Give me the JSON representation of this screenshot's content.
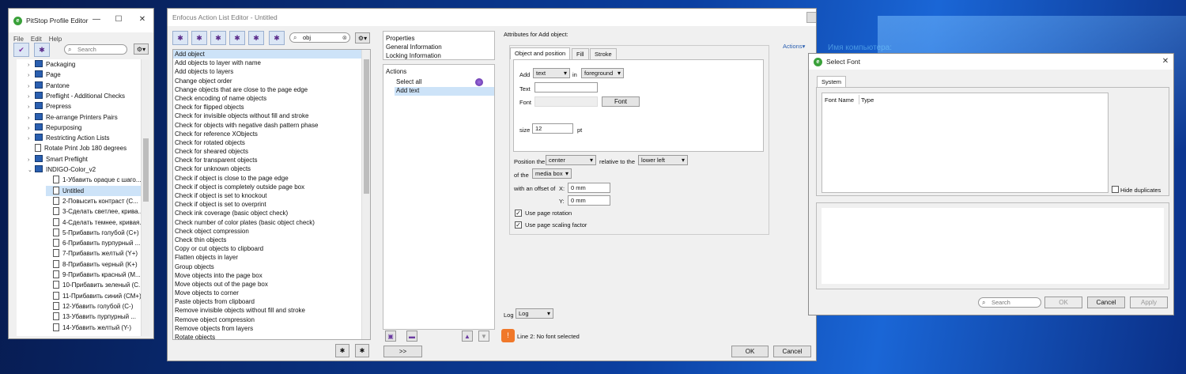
{
  "desktop": {
    "bg_text": "Имя компьютера:"
  },
  "profile_editor": {
    "title": "PitStop Profile Editor",
    "menu": [
      "File",
      "Edit",
      "Help"
    ],
    "search_placeholder": "Search",
    "tree": [
      {
        "label": "Packaging",
        "level": 1,
        "kind": "folder",
        "arrow": "›"
      },
      {
        "label": "Page",
        "level": 1,
        "kind": "folder",
        "arrow": "›"
      },
      {
        "label": "Pantone",
        "level": 1,
        "kind": "folder",
        "arrow": "›"
      },
      {
        "label": "Preflight - Additional Checks",
        "level": 1,
        "kind": "folder",
        "arrow": "›"
      },
      {
        "label": "Prepress",
        "level": 1,
        "kind": "folder",
        "arrow": "›"
      },
      {
        "label": "Re-arrange Printers Pairs",
        "level": 1,
        "kind": "folder",
        "arrow": "›"
      },
      {
        "label": "Repurposing",
        "level": 1,
        "kind": "folder",
        "arrow": "›"
      },
      {
        "label": "Restricting Action Lists",
        "level": 1,
        "kind": "folder",
        "arrow": "›"
      },
      {
        "label": "Rotate Print Job 180 degrees",
        "level": 1,
        "kind": "doc",
        "arrow": ""
      },
      {
        "label": "Smart Preflight",
        "level": 1,
        "kind": "folder",
        "arrow": "›"
      },
      {
        "label": "INDIGO-Color_v2",
        "level": 1,
        "kind": "folder",
        "arrow": "⌄"
      },
      {
        "label": "1-Убавить opaque с шаго...",
        "level": 2,
        "kind": "doc",
        "arrow": ""
      },
      {
        "label": "Untitled",
        "level": 2,
        "kind": "doc",
        "arrow": "",
        "selected": true
      },
      {
        "label": "2-Повысить контраст (C...",
        "level": 2,
        "kind": "doc",
        "arrow": ""
      },
      {
        "label": "3-Сделать светлее, крива...",
        "level": 2,
        "kind": "doc",
        "arrow": ""
      },
      {
        "label": "4-Сделать темнее, кривая...",
        "level": 2,
        "kind": "doc",
        "arrow": ""
      },
      {
        "label": "5-Прибавить голубой (C+)",
        "level": 2,
        "kind": "doc",
        "arrow": ""
      },
      {
        "label": "6-Прибавить пурпурный ...",
        "level": 2,
        "kind": "doc",
        "arrow": ""
      },
      {
        "label": "7-Прибавить желтый (Y+)",
        "level": 2,
        "kind": "doc",
        "arrow": ""
      },
      {
        "label": "8-Прибавить черный (K+)",
        "level": 2,
        "kind": "doc",
        "arrow": ""
      },
      {
        "label": "9-Прибавить красный (M...",
        "level": 2,
        "kind": "doc",
        "arrow": ""
      },
      {
        "label": "10-Прибавить зеленый (C...",
        "level": 2,
        "kind": "doc",
        "arrow": ""
      },
      {
        "label": "11-Прибавить синий (CM+)",
        "level": 2,
        "kind": "doc",
        "arrow": ""
      },
      {
        "label": "12-Убавить голубой (C-)",
        "level": 2,
        "kind": "doc",
        "arrow": ""
      },
      {
        "label": "13-Убавить пурпурный ...",
        "level": 2,
        "kind": "doc",
        "arrow": ""
      },
      {
        "label": "14-Убавить желтый (Y-)",
        "level": 2,
        "kind": "doc",
        "arrow": ""
      }
    ]
  },
  "action_editor": {
    "title": "Enfocus Action List Editor - Untitled",
    "search_value": "obj",
    "actions": [
      "Add object",
      "Add objects to layer with name",
      "Add objects to layers",
      "Change object order",
      "Change objects that are close to the page edge",
      "Check encoding of name objects",
      "Check for flipped objects",
      "Check for invisible objects without fill and stroke",
      "Check for objects with negative dash pattern phase",
      "Check for reference XObjects",
      "Check for rotated objects",
      "Check for sheared objects",
      "Check for transparent objects",
      "Check for unknown objects",
      "Check if object is close to the page edge",
      "Check if object is completely outside page box",
      "Check if object is set to knockout",
      "Check if object is set to overprint",
      "Check ink coverage (basic object check)",
      "Check number of color plates (basic object check)",
      "Check object compression",
      "Check thin objects",
      "Copy or cut objects to clipboard",
      "Flatten objects in layer",
      "Group objects",
      "Move objects into the page box",
      "Move objects out of the page box",
      "Move objects to corner",
      "Paste objects from clipboard",
      "Remove invisible objects without fill and stroke",
      "Remove object compression",
      "Remove objects from layers",
      "Rotate objects"
    ],
    "info_items": [
      "Properties",
      "General Information",
      "Locking Information"
    ],
    "actions_panel_title": "Actions",
    "list_actions": [
      "Select all",
      "Add text"
    ],
    "move_button": ">>",
    "attributes_title": "Attributes for Add object:",
    "actions_link": "Actions",
    "tabs": [
      "Object and position",
      "Fill",
      "Stroke"
    ],
    "add_label": "Add",
    "add_value": "text",
    "in_label": "in",
    "in_value": "foreground",
    "text_label": "Text",
    "text_value": "",
    "font_label": "Font",
    "font_value": "",
    "font_button": "Font",
    "size_label": "size",
    "size_value": "12",
    "size_unit": "pt",
    "position_label": "Position the",
    "position_value": "center",
    "relative_label": "relative to the",
    "relative_value": "lower left",
    "of_label": "of the",
    "of_value": "media box",
    "offset_label": "with an offset of",
    "x_label": "X:",
    "x_value": "0 mm",
    "y_label": "Y:",
    "y_value": "0 mm",
    "use_rotation": "Use page rotation",
    "use_scaling": "Use page scaling factor",
    "log_label": "Log",
    "log_value": "Log",
    "status_text": "Line 2: No font selected",
    "ok": "OK",
    "cancel": "Cancel"
  },
  "select_font": {
    "title": "Select Font",
    "tab": "System",
    "col_font": "Font Name",
    "col_type": "Type",
    "hide_duplicates": "Hide duplicates",
    "search_placeholder": "Search",
    "ok": "OK",
    "cancel": "Cancel",
    "apply": "Apply"
  }
}
